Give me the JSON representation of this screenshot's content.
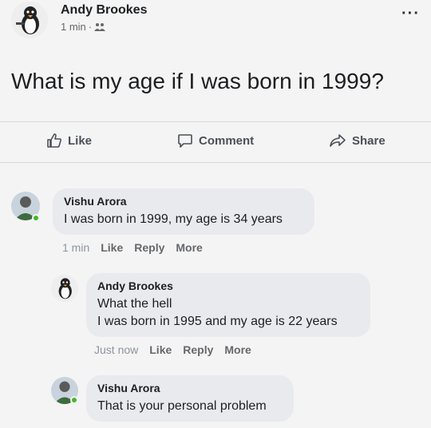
{
  "post": {
    "author": "Andy Brookes",
    "time": "1 min",
    "separator": "·",
    "more": "···",
    "text": "What is my age if I was born in 1999?"
  },
  "actions": {
    "like": "Like",
    "comment": "Comment",
    "share": "Share"
  },
  "comments": [
    {
      "author": "Vishu Arora",
      "text": "I was born in 1999, my age is 34 years",
      "time": "1 min",
      "like": "Like",
      "reply": "Reply",
      "more": "More"
    },
    {
      "author": "Andy Brookes",
      "text": "What the hell\nI was born in 1995 and my age is 22 years",
      "time": "Just now",
      "like": "Like",
      "reply": "Reply",
      "more": "More"
    },
    {
      "author": "Vishu Arora",
      "text": "That is your personal problem"
    }
  ],
  "colors": {
    "background": "#f4f4f4",
    "bubble": "#e9eaee",
    "online": "#42b72a",
    "muted": "#65676b"
  },
  "icons": [
    "penguin-avatar-icon",
    "people-icon",
    "thumbs-up-icon",
    "comment-icon",
    "share-icon"
  ]
}
